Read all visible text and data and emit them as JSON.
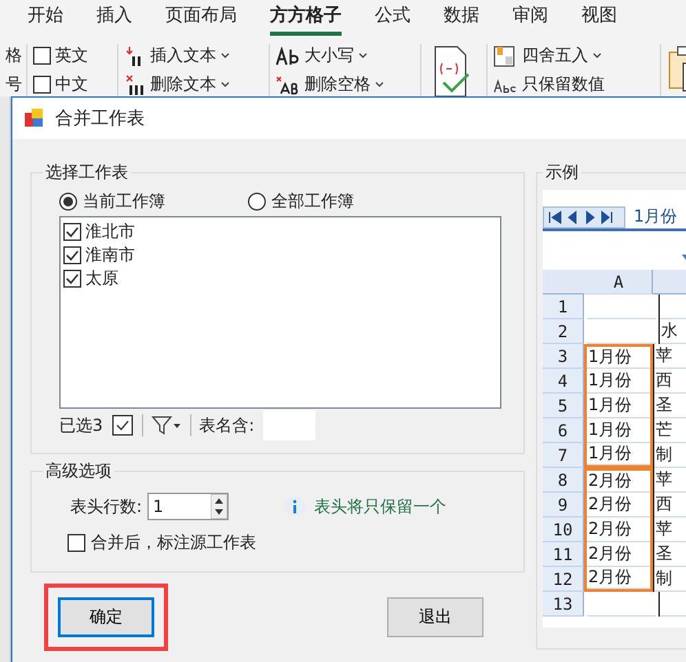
{
  "ribbon": {
    "tabs": [
      {
        "label": "开始",
        "selected": false
      },
      {
        "label": "插入",
        "selected": false
      },
      {
        "label": "页面布局",
        "selected": false
      },
      {
        "label": "方方格子",
        "selected": true
      },
      {
        "label": "公式",
        "selected": false
      },
      {
        "label": "数据",
        "selected": false
      },
      {
        "label": "审阅",
        "selected": false
      },
      {
        "label": "视图",
        "selected": false
      }
    ],
    "columns": [
      {
        "items": [
          {
            "kind": "text",
            "label": "格"
          },
          {
            "kind": "text",
            "label": "号"
          }
        ]
      },
      {
        "items": [
          {
            "kind": "checkbox",
            "label": "英文",
            "checked": false
          },
          {
            "kind": "checkbox",
            "label": "中文",
            "checked": false
          }
        ]
      },
      {
        "items": [
          {
            "kind": "command",
            "label": "插入文本",
            "dropdown": true
          },
          {
            "kind": "command",
            "label": "删除文本",
            "dropdown": true
          }
        ]
      },
      {
        "items": [
          {
            "kind": "command",
            "label": "大小写",
            "dropdown": true
          },
          {
            "kind": "command",
            "label": "删除空格",
            "dropdown": true
          }
        ]
      },
      {
        "items": [
          {
            "kind": "big"
          }
        ]
      },
      {
        "items": [
          {
            "kind": "command",
            "label": "四舍五入",
            "dropdown": true
          },
          {
            "kind": "command",
            "label": "只保留数值",
            "dropdown": false
          }
        ]
      },
      {
        "items": [
          {
            "kind": "big"
          }
        ]
      }
    ]
  },
  "dialog": {
    "title": "合并工作表",
    "select_group": {
      "title": "选择工作表",
      "scope": [
        {
          "label": "当前工作簿",
          "selected": true
        },
        {
          "label": "全部工作簿",
          "selected": false
        }
      ],
      "sheets": [
        {
          "label": "淮北市",
          "checked": true
        },
        {
          "label": "淮南市",
          "checked": true
        },
        {
          "label": "太原",
          "checked": true
        }
      ],
      "selected_count": "已选3",
      "name_label": "表名含:"
    },
    "advanced": {
      "title": "高级选项",
      "header_rows_label": "表头行数:",
      "header_rows": "1",
      "info": "表头将只保留一个",
      "annotate": {
        "label": "合并后，标注源工作表",
        "checked": false
      }
    },
    "buttons": [
      {
        "label": "确定",
        "focused": true
      },
      {
        "label": "退出",
        "focused": false
      }
    ],
    "example": {
      "title": "示例",
      "sheet_tab": "1月份",
      "column_header": "A",
      "groups": [
        {
          "highlighted": false,
          "rows": [
            {
              "num": "1",
              "a": "",
              "b": ""
            },
            {
              "num": "2",
              "a": "",
              "b": "水"
            }
          ]
        },
        {
          "highlighted": true,
          "rows": [
            {
              "num": "3",
              "a": "1月份",
              "b": "苹"
            },
            {
              "num": "4",
              "a": "1月份",
              "b": "西"
            },
            {
              "num": "5",
              "a": "1月份",
              "b": "圣"
            },
            {
              "num": "6",
              "a": "1月份",
              "b": "芒"
            },
            {
              "num": "7",
              "a": "1月份",
              "b": "制"
            }
          ]
        },
        {
          "highlighted": true,
          "rows": [
            {
              "num": "8",
              "a": "2月份",
              "b": "苹"
            },
            {
              "num": "9",
              "a": "2月份",
              "b": "西"
            },
            {
              "num": "10",
              "a": "2月份",
              "b": "苹"
            },
            {
              "num": "11",
              "a": "2月份",
              "b": "圣"
            },
            {
              "num": "12",
              "a": "2月份",
              "b": "制"
            }
          ]
        },
        {
          "highlighted": false,
          "rows": [
            {
              "num": "13",
              "a": "",
              "b": ""
            }
          ]
        }
      ]
    }
  }
}
